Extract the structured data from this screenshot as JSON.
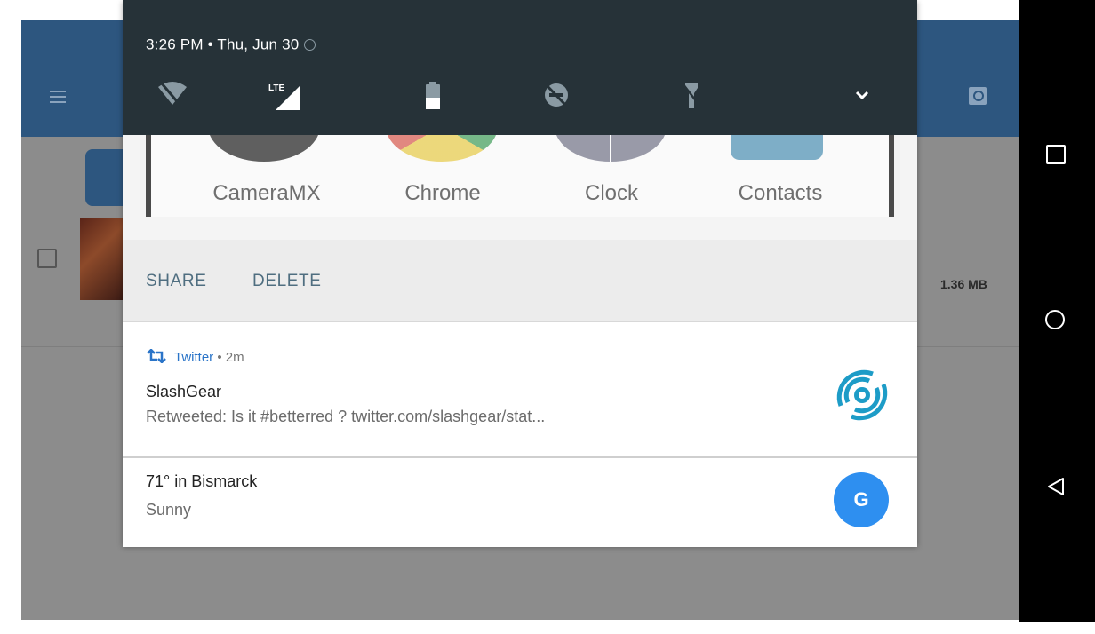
{
  "status": {
    "time_date": "3:26 PM • Thu, Jun 30",
    "alarm_icon": "alarm-icon"
  },
  "quick_settings": [
    {
      "name": "wifi-off-icon"
    },
    {
      "name": "lte-signal-icon",
      "label": "LTE"
    },
    {
      "name": "battery-icon"
    },
    {
      "name": "do-not-disturb-icon"
    },
    {
      "name": "flashlight-off-icon"
    },
    {
      "name": "chevron-down-icon"
    }
  ],
  "screenshot_notification": {
    "apps": [
      "CameraMX",
      "Chrome",
      "Clock",
      "Contacts"
    ],
    "share_label": "SHARE",
    "delete_label": "DELETE"
  },
  "twitter_notification": {
    "app_name": "Twitter",
    "time": " • 2m",
    "title": "SlashGear",
    "text": "Retweeted: Is it #betterred ? twitter.com/slashgear/stat...",
    "app_icon": "retweet-icon",
    "avatar_icon": "slashgear-logo-icon"
  },
  "weather_notification": {
    "title": "71° in Bismarck",
    "text": "Sunny",
    "badge_letter": "G"
  },
  "background_app": {
    "file_size": "1.36 MB"
  },
  "colors": {
    "shade_header": "#263238",
    "app_bar": "#2d567f",
    "twitter_blue": "#2a74c8",
    "google_blue": "#2e8ff0"
  }
}
